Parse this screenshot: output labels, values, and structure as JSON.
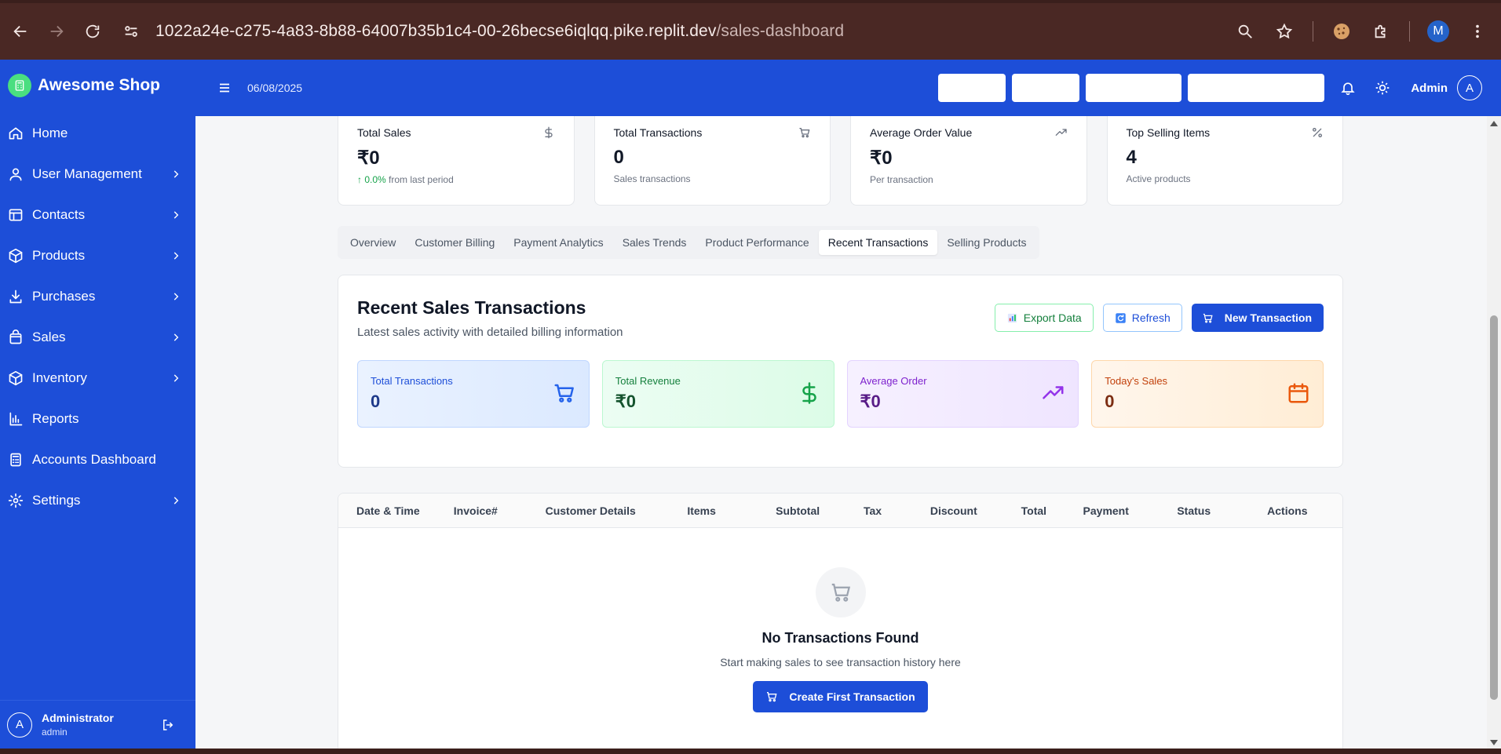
{
  "browser": {
    "url_host": "1022a24e-c275-4a83-8b88-64007b35b1c4-00-26becse6iqlqq.pike.replit.dev",
    "url_path": "/sales-dashboard",
    "profile_initial": "M"
  },
  "sidebar": {
    "brand": "Awesome Shop",
    "items": [
      {
        "label": "Home",
        "icon": "home-icon",
        "chevron": false
      },
      {
        "label": "User Management",
        "icon": "user-icon",
        "chevron": true
      },
      {
        "label": "Contacts",
        "icon": "contacts-icon",
        "chevron": true
      },
      {
        "label": "Products",
        "icon": "box-icon",
        "chevron": true
      },
      {
        "label": "Purchases",
        "icon": "download-icon",
        "chevron": true
      },
      {
        "label": "Sales",
        "icon": "bag-icon",
        "chevron": true
      },
      {
        "label": "Inventory",
        "icon": "box-icon",
        "chevron": true
      },
      {
        "label": "Reports",
        "icon": "bar-chart-icon",
        "chevron": false
      },
      {
        "label": "Accounts Dashboard",
        "icon": "calculator-icon",
        "chevron": false
      },
      {
        "label": "Settings",
        "icon": "gear-icon",
        "chevron": true
      }
    ],
    "user": {
      "initial": "A",
      "name": "Administrator",
      "role": "admin"
    }
  },
  "topbar": {
    "date": "06/08/2025",
    "user": "Admin",
    "avatar_initial": "A"
  },
  "stats": [
    {
      "title": "Total Sales",
      "icon": "dollar-icon",
      "value": "₹0",
      "sub_up": "0.0%",
      "sub": "from last period"
    },
    {
      "title": "Total Transactions",
      "icon": "cart-icon",
      "value": "0",
      "sub_up": "",
      "sub": "Sales transactions"
    },
    {
      "title": "Average Order Value",
      "icon": "trending-up-icon",
      "value": "₹0",
      "sub_up": "",
      "sub": "Per transaction"
    },
    {
      "title": "Top Selling Items",
      "icon": "percent-icon",
      "value": "4",
      "sub_up": "",
      "sub": "Active products"
    }
  ],
  "tabs": [
    {
      "label": "Overview",
      "active": false
    },
    {
      "label": "Customer Billing",
      "active": false
    },
    {
      "label": "Payment Analytics",
      "active": false
    },
    {
      "label": "Sales Trends",
      "active": false
    },
    {
      "label": "Product Performance",
      "active": false
    },
    {
      "label": "Recent Transactions",
      "active": true
    },
    {
      "label": "Selling Products",
      "active": false
    }
  ],
  "panel": {
    "title": "Recent Sales Transactions",
    "subtitle": "Latest sales activity with detailed billing information",
    "export_label": "Export Data",
    "refresh_label": "Refresh",
    "new_label": "New Transaction",
    "summary": [
      {
        "label": "Total Transactions",
        "value": "0",
        "tone": "blue",
        "icon": "cart-icon"
      },
      {
        "label": "Total Revenue",
        "value": "₹0",
        "tone": "green",
        "icon": "dollar-icon"
      },
      {
        "label": "Average Order",
        "value": "₹0",
        "tone": "purple",
        "icon": "trending-up-icon"
      },
      {
        "label": "Today's Sales",
        "value": "0",
        "tone": "orange",
        "icon": "calendar-icon"
      }
    ]
  },
  "table": {
    "columns": [
      "Date & Time",
      "Invoice#",
      "Customer Details",
      "Items",
      "Subtotal",
      "Tax",
      "Discount",
      "Total",
      "Payment",
      "Status",
      "Actions"
    ],
    "empty_title": "No Transactions Found",
    "empty_sub": "Start making sales to see transaction history here",
    "create_label": "Create First Transaction"
  },
  "colors": {
    "primary": "#1d4ed8",
    "chrome": "#4a2824"
  }
}
